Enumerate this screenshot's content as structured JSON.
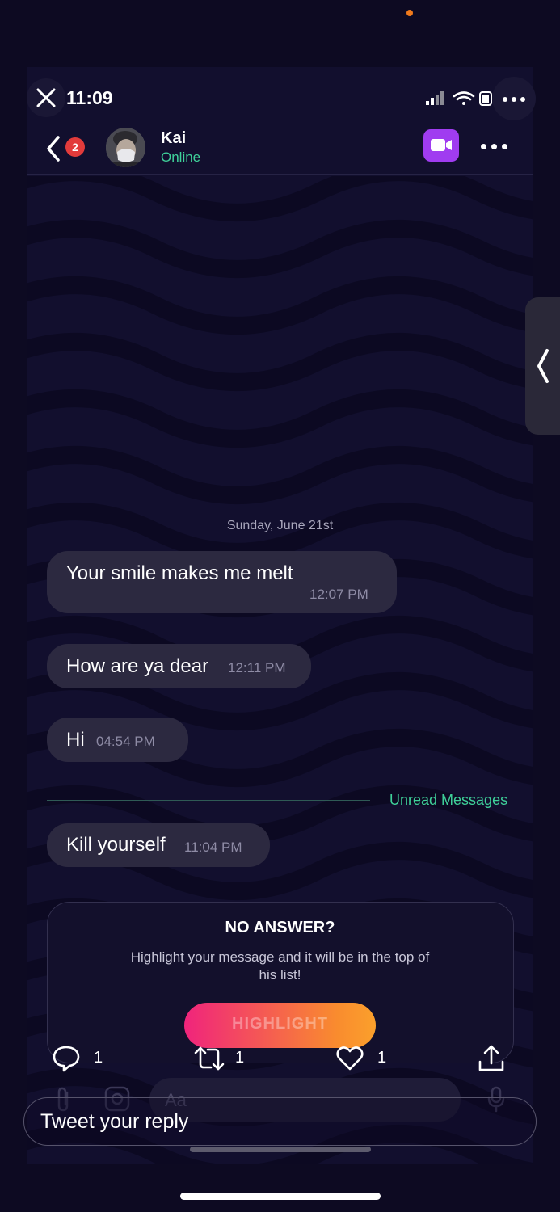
{
  "status_bar": {
    "time": "11:09"
  },
  "header": {
    "back_badge": "2",
    "contact_name": "Kai",
    "contact_status": "Online"
  },
  "conversation": {
    "date_label": "Sunday, June 21st",
    "messages": [
      {
        "text": "Your smile makes me melt",
        "time": "12:07 PM"
      },
      {
        "text": "How are ya dear",
        "time": "12:11 PM"
      },
      {
        "text": "Hi",
        "time": "04:54 PM"
      },
      {
        "text": "Kill yourself",
        "time": "11:04 PM"
      }
    ],
    "unread_label": "Unread Messages"
  },
  "highlight_card": {
    "title": "NO ANSWER?",
    "description": "Highlight your message and it will be in the top of his list!",
    "button_label": "HIGHLIGHT"
  },
  "composer": {
    "placeholder": "Aa"
  },
  "tweet_actions": {
    "replies": "1",
    "retweets": "1",
    "likes": "1",
    "reply_placeholder": "Tweet your reply"
  },
  "colors": {
    "accent_green": "#3fd19a",
    "video_purple": "#a03cf0",
    "badge_red": "#e23b3b",
    "highlight_gradient_start": "#f0247c",
    "highlight_gradient_end": "#fba02c"
  }
}
